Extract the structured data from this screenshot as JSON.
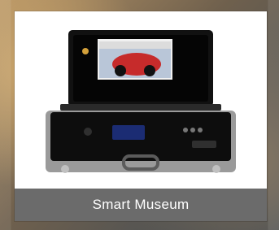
{
  "card": {
    "caption": "Smart Museum"
  },
  "image": {
    "subject": "aluminum-briefcase-display-player"
  },
  "colors": {
    "caption_bg": "#6b6b6b",
    "caption_text": "#ffffff",
    "card_bg": "#ffffff"
  }
}
